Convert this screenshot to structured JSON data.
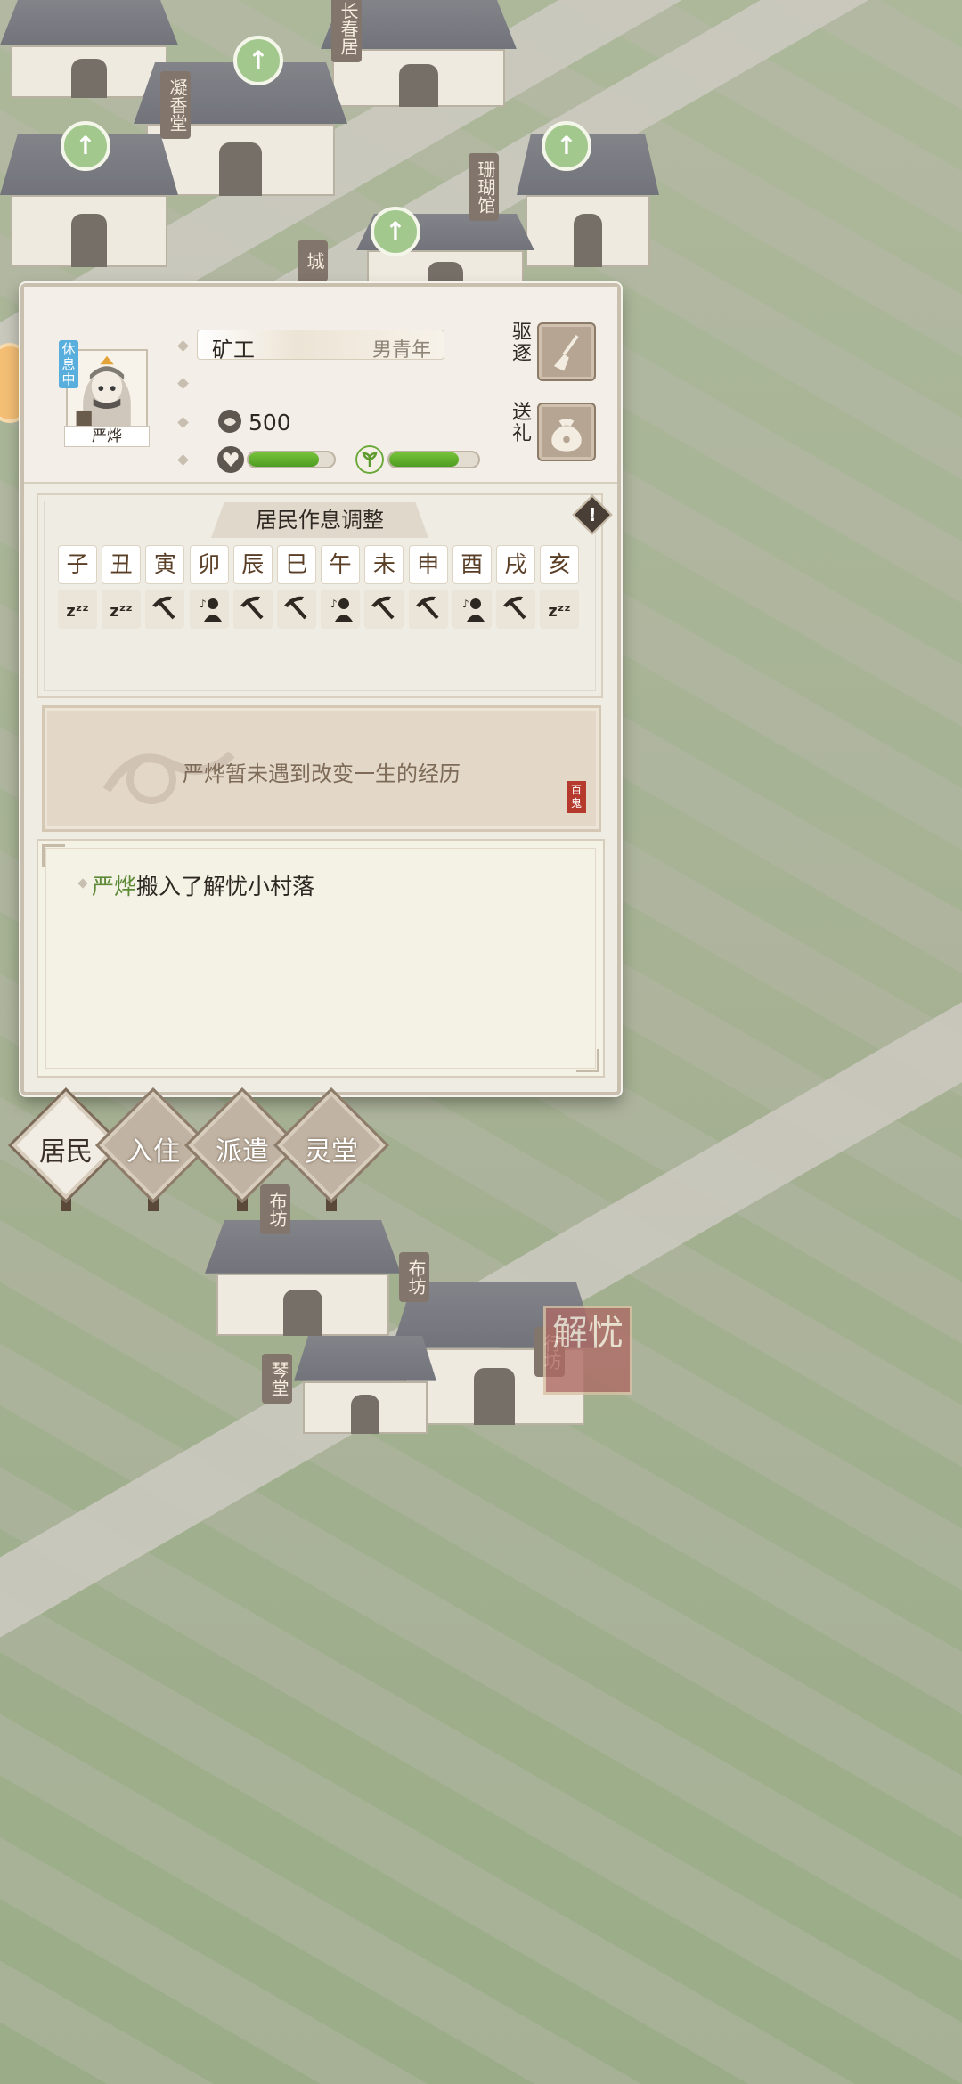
{
  "background": {
    "signs": [
      "长春居",
      "凝香堂",
      "珊瑚馆",
      "城南",
      "布坊",
      "布坊",
      "行坊",
      "琴堂"
    ]
  },
  "resident": {
    "status_badge": "休息中",
    "name": "严烨",
    "job": "矿工",
    "gender_age": "男青年",
    "coins": "500",
    "mood_level": 0.82,
    "health_level": 0.78
  },
  "side_actions": {
    "evict_label": "驱逐",
    "gift_label": "送礼"
  },
  "schedule": {
    "title": "居民作息调整",
    "hours": [
      "子",
      "丑",
      "寅",
      "卯",
      "辰",
      "巳",
      "午",
      "未",
      "申",
      "酉",
      "戌",
      "亥"
    ],
    "activities": [
      "sleep",
      "sleep",
      "work",
      "leisure",
      "work",
      "work",
      "leisure",
      "work",
      "work",
      "leisure",
      "work",
      "sleep"
    ]
  },
  "story": {
    "text": "严烨暂未遇到改变一生的经历",
    "seal": "百鬼"
  },
  "log": {
    "entry_name": "严烨",
    "entry_text": "搬入了解忧小村落"
  },
  "tabs": [
    "居民",
    "入住",
    "派遣",
    "灵堂"
  ],
  "corner_logo": "解忧",
  "colors": {
    "bar_fill": "#5fae2e",
    "badge_blue": "#58aedc",
    "highlight_green": "#5c8a36"
  }
}
